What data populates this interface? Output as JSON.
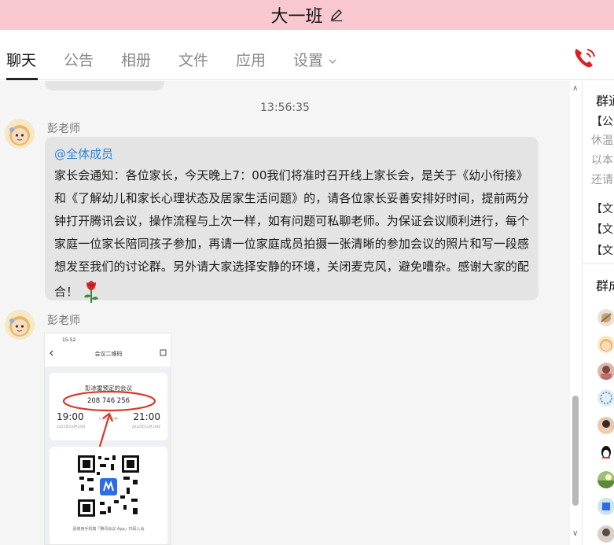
{
  "window": {
    "title": "大一班"
  },
  "tabs": [
    {
      "label": "聊天",
      "active": true
    },
    {
      "label": "公告"
    },
    {
      "label": "相册"
    },
    {
      "label": "文件"
    },
    {
      "label": "应用"
    },
    {
      "label": "设置"
    }
  ],
  "chat": {
    "timestamp": "13:56:35",
    "messages": [
      {
        "sender": "彭老师",
        "mention": "@全体成员",
        "text": "家长会通知：各位家长，今天晚上7：00我们将准时召开线上家长会，是关于《幼小衔接》和《了解幼儿和家长心理状态及居家生活问题》的，请各位家长妥善安排好时间，提前两分钟打开腾讯会议，操作流程与上次一样，如有问题可私聊老师。为保证会议顺利进行，每个家庭一位家长陪同孩子参加，再请一位家庭成员拍摄一张清晰的参加会议的照片和写一段感想发至我们的讨论群。另外请大家选择安静的环境，关闭麦克风，避免嘈杂。感谢大家的配合！"
      },
      {
        "sender": "彭老师",
        "image": {
          "status_time": "15:52",
          "header": "会议二维码",
          "meeting_title": "彭冰雷预定的会议",
          "meeting_id": "208 746 256",
          "start_time": "19:00",
          "end_time": "21:00",
          "start_date": "2022年03月19日",
          "end_date": "2022年03月19日",
          "duration": "0小时0分钟",
          "footer": "请使用手机端「腾讯会议 App」扫码入会"
        }
      }
    ]
  },
  "sidebar": {
    "notice_title": "群通",
    "notice_lines": [
      "【公",
      "休温",
      "以本",
      "还请"
    ],
    "file_lines": [
      "【文",
      "【文",
      "【文"
    ],
    "members_title": "群成"
  },
  "colors": {
    "titlebar_bg": "#f9c7d0",
    "bubble_bg": "#e4e4e4",
    "mention": "#2f86d6",
    "phone_icon": "#e02020",
    "annotation": "#d63a2a"
  }
}
